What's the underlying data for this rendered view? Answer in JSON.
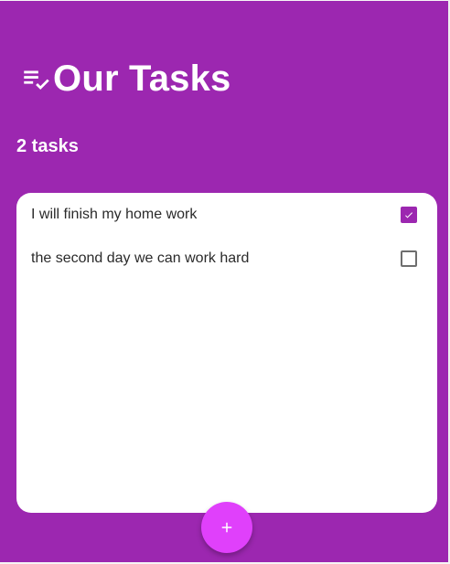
{
  "theme": {
    "background": "#9c27b0",
    "accent": "#e040fb",
    "panel": "#ffffff",
    "text_primary": "#ffffff",
    "text_dark": "#2a2a2a"
  },
  "header": {
    "icon": "checklist-icon",
    "title": "Our Tasks"
  },
  "summary": {
    "count_text": "2 tasks"
  },
  "tasks": [
    {
      "label": "I will finish my home work",
      "checked": true,
      "checkbox_icon": "checked-checkbox-icon"
    },
    {
      "label": "the second day we can work hard",
      "checked": false,
      "checkbox_icon": "unchecked-checkbox-icon"
    }
  ],
  "actions": {
    "add_icon": "plus-icon"
  }
}
